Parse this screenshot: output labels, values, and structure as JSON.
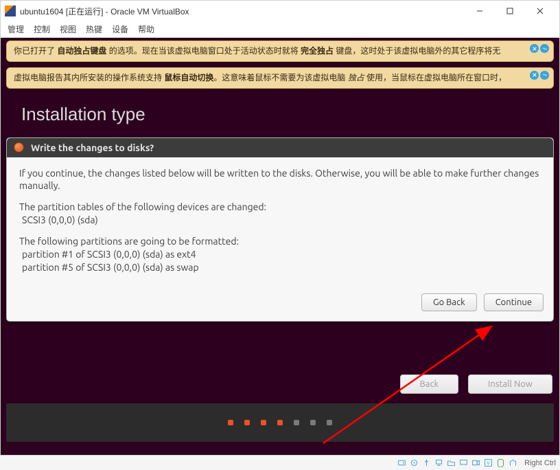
{
  "window": {
    "title": "ubuntu1604 [正在运行] - Oracle VM VirtualBox",
    "menu": [
      "管理",
      "控制",
      "视图",
      "热键",
      "设备",
      "帮助"
    ]
  },
  "notifications": [
    {
      "pre": "你已打开了 ",
      "b1": "自动独占键盘",
      "mid": " 的选项。现在当该虚拟电脑窗口处于活动状态时就将 ",
      "b2": "完全独占",
      "post": " 键盘，这时处于该虚拟电脑外的其它程序将无"
    },
    {
      "pre": "虚拟电脑报告其内所安装的操作系统支持 ",
      "b1": "鼠标自动切换",
      "mid": "。这意味着鼠标不需要为该虚拟电脑 ",
      "i1": "独占",
      "post": " 使用，当鼠标在虚拟电脑所在窗口时，"
    }
  ],
  "install": {
    "header": "Installation type",
    "dialog_title": "Write the changes to disks?",
    "body": {
      "intro": "If you continue, the changes listed below will be written to the disks. Otherwise, you will be able to make further changes manually.",
      "tables_head": "The partition tables of the following devices are changed:",
      "device": "SCSI3 (0,0,0) (sda)",
      "format_head": "The following partitions are going to be formatted:",
      "part1": "partition #1 of SCSI3 (0,0,0) (sda) as ext4",
      "part2": "partition #5 of SCSI3 (0,0,0) (sda) as swap"
    },
    "go_back": "Go Back",
    "continue": "Continue",
    "footer_back": "Back",
    "footer_install": "Install Now"
  },
  "statusbar": {
    "ctrl": "Right Ctrl"
  }
}
